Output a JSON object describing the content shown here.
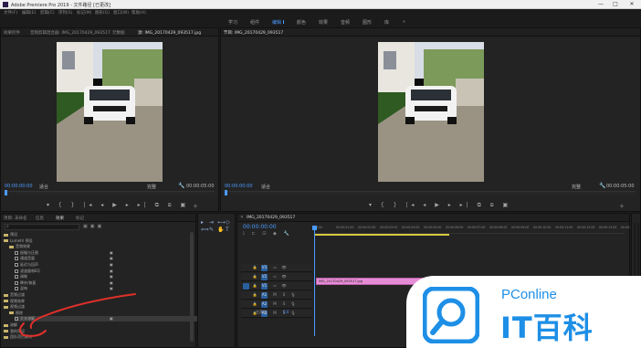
{
  "window": {
    "title": "Adobe Premiere Pro 2019 - 文件路径 [已更改]",
    "buttons": [
      "—",
      "□",
      "✕"
    ]
  },
  "menu": {
    "items": [
      "文件(F)",
      "编辑(E)",
      "剪辑(C)",
      "序列(S)",
      "标记(M)",
      "图形(G)",
      "窗口(W)",
      "帮助(H)"
    ]
  },
  "workspaces": {
    "items": [
      {
        "label": "学习",
        "active": false
      },
      {
        "label": "组件",
        "active": false
      },
      {
        "label": "编辑",
        "active": true
      },
      {
        "label": "颜色",
        "active": false
      },
      {
        "label": "效果",
        "active": false
      },
      {
        "label": "音频",
        "active": false
      },
      {
        "label": "图形",
        "active": false
      },
      {
        "label": "库",
        "active": false
      }
    ],
    "more": "»"
  },
  "source_panel": {
    "tabs": [
      "效果控件",
      "音频剪辑混合器: IMG_20170429_093517",
      "元数据",
      "源: IMG_20170429_093517.jpg"
    ],
    "timecode_left": "00:00:00:00",
    "fit_label": "适合",
    "full_label": "完整",
    "timecode_right": "00:00:05:00"
  },
  "program_panel": {
    "tab": "节目: IMG_20170429_093517",
    "timecode_left": "00:00:00:00",
    "fit_label": "适合",
    "full_label": "完整",
    "timecode_right": "00:00:05:00"
  },
  "effects_panel": {
    "tabs": [
      "项目: 未命名",
      "信息",
      "效果",
      "标记"
    ],
    "items": [
      {
        "label": "预设",
        "kind": "folder",
        "indent": 0
      },
      {
        "label": "Lumetri 预设",
        "kind": "folder",
        "indent": 0
      },
      {
        "label": "音频效果",
        "kind": "folder",
        "indent": 1
      },
      {
        "label": "振幅与压限",
        "kind": "fx",
        "indent": 2
      },
      {
        "label": "通道音量",
        "kind": "fx",
        "indent": 2
      },
      {
        "label": "延迟与回声",
        "kind": "fx",
        "indent": 2
      },
      {
        "label": "滤波器和EQ",
        "kind": "fx",
        "indent": 2
      },
      {
        "label": "调制",
        "kind": "fx",
        "indent": 2
      },
      {
        "label": "降杂/恢复",
        "kind": "fx",
        "indent": 2
      },
      {
        "label": "混响",
        "kind": "fx",
        "indent": 2
      },
      {
        "label": "音频过渡",
        "kind": "folder",
        "indent": 0
      },
      {
        "label": "视频效果",
        "kind": "folder",
        "indent": 0
      },
      {
        "label": "视频过渡",
        "kind": "folder",
        "indent": 0
      },
      {
        "label": "擦除",
        "kind": "folder",
        "indent": 1
      },
      {
        "label": "交叉溶解",
        "kind": "fx",
        "indent": 2
      },
      {
        "label": "溶解",
        "kind": "folder",
        "indent": 0
      },
      {
        "label": "我的预设",
        "kind": "folder",
        "indent": 0
      },
      {
        "label": "团队项目素材",
        "kind": "folder",
        "indent": 0
      }
    ]
  },
  "timeline": {
    "tab": "IMG_20170429_093517",
    "timecode": "00:00:00:00",
    "ruler_labels": [
      "00:00",
      "00:00:01:00",
      "00:00:02:00",
      "00:00:03:00",
      "00:00:04:00",
      "00:00:05:00",
      "00:00:06:00",
      "00:00:07:00",
      "00:00:08:00",
      "00:00:09:00",
      "00:00:10:00",
      "00:00:11:00",
      "00:00:12:00",
      "00:00:13:00",
      "00:00:14:00"
    ],
    "tracks": [
      {
        "label": "V3",
        "kind": "video"
      },
      {
        "label": "V2",
        "kind": "video"
      },
      {
        "label": "V1",
        "kind": "video"
      },
      {
        "label": "A1",
        "kind": "audio"
      },
      {
        "label": "A2",
        "kind": "audio"
      },
      {
        "label": "A3",
        "kind": "audio"
      }
    ],
    "master_label": "主声道",
    "master_value": "0.0",
    "clip_label": "IMG_20170429_093517.jpg"
  },
  "watermark": {
    "brand": "PConline",
    "logo_text": "IT百科"
  },
  "colors": {
    "accent": "#4a9bff",
    "clip": "#e68cd5",
    "folder": "#c8b46a",
    "annotation": "#e0302a"
  }
}
